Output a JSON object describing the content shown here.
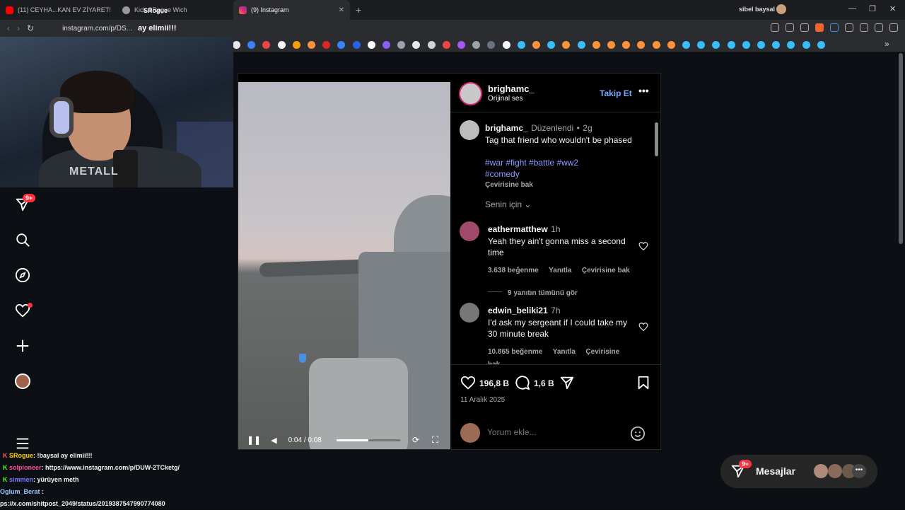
{
  "browser": {
    "tabs": [
      {
        "label": "(11) CEYHA...KAN EV ZİYARET!",
        "color": "#ff0000"
      },
      {
        "label": "Kick SRogue Wich",
        "color": "#999999"
      },
      {
        "label": "(9) Instagram",
        "color": "#e1306c"
      }
    ],
    "profile_name": "sibel baysal",
    "url": "instagram.com/p/DS...",
    "overlay_text": "ay elimii!!!",
    "overlay_name": "SRogue"
  },
  "post": {
    "author": "brighamc_",
    "audio": "Orijinal ses",
    "follow_label": "Takip Et",
    "caption": {
      "user": "brighamc_",
      "edited": "Düzenlendi",
      "dot": "•",
      "age": "2g",
      "text": "Tag that friend who wouldn't be phased",
      "tags": "#war #fight #battle #ww2 #comedy",
      "translate": "Çevirisine bak"
    },
    "sort_label": "Senin için",
    "comments": [
      {
        "user": "eathermatthew",
        "age": "1h",
        "text": "Yeah they ain't gonna miss a second time",
        "likes": "3.638 beğenme",
        "reply": "Yanıtla",
        "translate": "Çevirisine bak",
        "view_replies": "9 yanıtın tümünü gör"
      },
      {
        "user": "edwin_beliki21",
        "age": "7h",
        "text": "I'd ask my sergeant if I could take my 30 minute break",
        "likes": "10.865 beğenme",
        "reply": "Yanıtla",
        "translate": "Çevirisine bak"
      }
    ],
    "like_count": "196,8 B",
    "comment_count": "1,6 B",
    "date": "11 Aralık 2025",
    "comment_placeholder": "Yorum ekle...",
    "video_time": "0:04 / 0:08",
    "video_progress": 0.5
  },
  "sidebar": {
    "badge": "9+"
  },
  "chat": [
    {
      "user": "SRogue",
      "text": ": !baysal ay elimii!!!",
      "color": "#ff5c5c"
    },
    {
      "user": "solpioneer",
      "text": ": https://www.instagram.com/p/DUW-2TCketg/",
      "color": "#ff4fa0"
    },
    {
      "user": "simmen",
      "text": ": yürüyen meth",
      "color": "#7a7aff"
    },
    {
      "user": "Oglum_Berat",
      "text": ":",
      "color": "#9ac8ff"
    },
    {
      "user": "",
      "text": "ps://x.com/shitpost_2049/status/2019387547990774080",
      "color": "#ffffff"
    }
  ],
  "messages": {
    "label": "Mesajlar",
    "badge": "9+"
  }
}
